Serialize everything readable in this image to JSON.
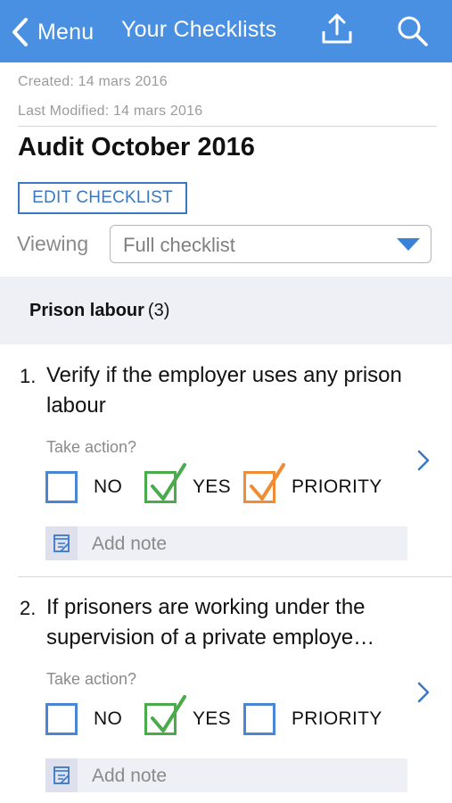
{
  "navbar": {
    "back_label": "Menu",
    "title": "Your Checklists",
    "icons": [
      "chevron-left-icon",
      "share-icon",
      "search-icon"
    ],
    "color": "#4a90e2"
  },
  "meta": {
    "created": "Created: 14 mars 2016",
    "modified": "Last Modified: 14 mars 2016"
  },
  "title": "Audit October 2016",
  "edit_button": "EDIT CHECKLIST",
  "viewing": {
    "label": "Viewing",
    "value": "Full checklist"
  },
  "section": {
    "name": "Prison labour",
    "count": "(3)"
  },
  "take_action_label": "Take action?",
  "note_placeholder": "Add note",
  "option_labels": {
    "no": "NO",
    "yes": "YES",
    "priority": "PRIORITY"
  },
  "items": [
    {
      "number": "1.",
      "text": "Verify if the employer uses any prison labour",
      "no": false,
      "yes": true,
      "priority": true
    },
    {
      "number": "2.",
      "text": "If prisoners are working under the supervision of a private employe…",
      "no": false,
      "yes": true,
      "priority": false
    }
  ],
  "colors": {
    "accent": "#4a90e2",
    "button_border": "#3a78c4",
    "yes_check": "#4aab4a",
    "priority_check": "#f08c33",
    "section_background": "#eff0f6"
  }
}
